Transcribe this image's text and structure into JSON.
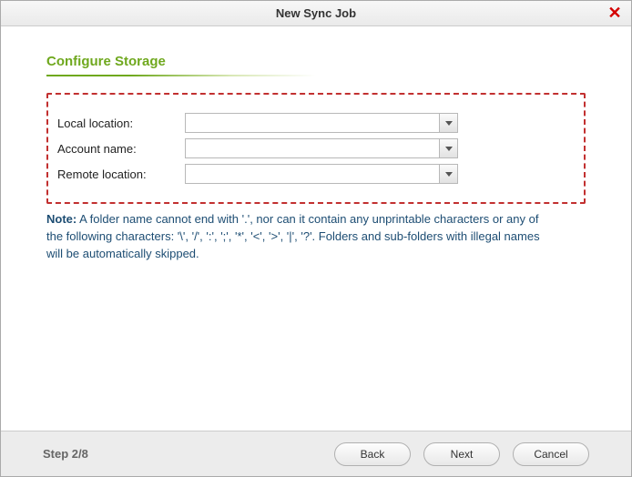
{
  "window": {
    "title": "New Sync Job"
  },
  "section": {
    "title": "Configure Storage"
  },
  "form": {
    "local_location": {
      "label": "Local location:",
      "value": ""
    },
    "account_name": {
      "label": "Account name:",
      "value": ""
    },
    "remote_location": {
      "label": "Remote location:",
      "value": ""
    }
  },
  "note": {
    "prefix": "Note:",
    "text": " A folder name cannot end with '.', nor can it contain any unprintable characters or any of the following characters: '\\', '/', ':', ';', '*', '<', '>', '|', '?'. Folders and sub-folders with illegal names will be automatically skipped."
  },
  "footer": {
    "step": "Step 2/8",
    "back": "Back",
    "next": "Next",
    "cancel": "Cancel"
  }
}
